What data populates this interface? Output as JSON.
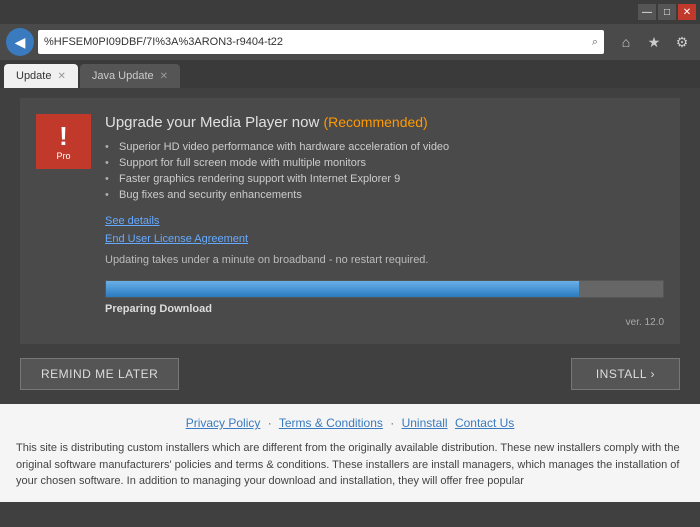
{
  "browser": {
    "title_bar": {
      "minimize_label": "—",
      "maximize_label": "□",
      "close_label": "✕"
    },
    "nav_bar": {
      "back_arrow": "◀",
      "address": "%HFSEM0PI09DBF/7I%3A%3ARON3-r9404-t22",
      "search_icon": "⌕",
      "refresh_icon": "⟳",
      "star_icon": "★",
      "home_icon": "⌂"
    },
    "tabs": [
      {
        "label": "Update",
        "active": true
      },
      {
        "label": "Java Update",
        "active": false
      }
    ]
  },
  "upgrade_box": {
    "pro_label": "Pro",
    "pro_exclamation": "!",
    "title": "Upgrade your Media Player now",
    "recommended": "(Recommended)",
    "features": [
      "Superior HD video performance with hardware acceleration of video",
      "Support for full screen mode with multiple monitors",
      "Faster graphics rendering support with Internet Explorer 9",
      "Bug fixes and security enhancements"
    ],
    "see_details_link": "See details",
    "eula_link": "End User License Agreement",
    "update_note": "Updating takes under a minute on broadband - no restart required.",
    "progress_width": "85%",
    "preparing_text": "Preparing Download",
    "version_text": "ver. 12.0"
  },
  "buttons": {
    "remind_label": "REMIND ME LATER",
    "install_label": "INSTALL ›"
  },
  "footer": {
    "privacy_policy": "Privacy Policy",
    "terms": "Terms & Conditions",
    "uninstall": "Uninstall",
    "contact": "Contact Us",
    "separator1": "·",
    "separator2": "·",
    "body_text": "This site is distributing custom installers which are different from the originally available distribution. These new installers comply with the original software manufacturers' policies and terms & conditions. These installers are install managers, which manages the installation of your chosen software. In addition to managing your download and installation, they will offer free popular"
  }
}
